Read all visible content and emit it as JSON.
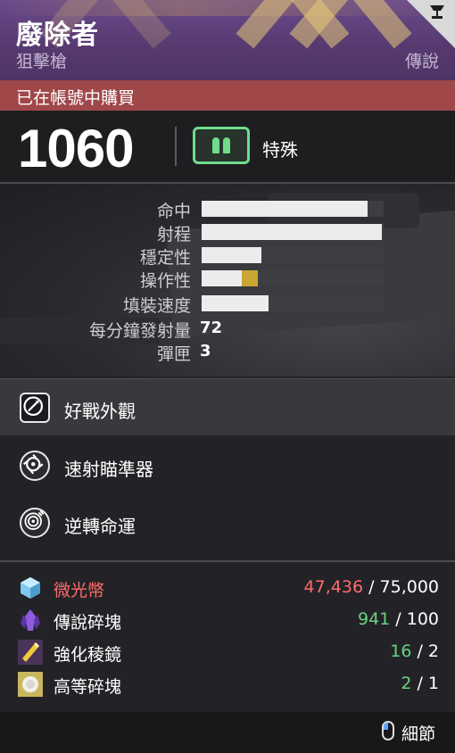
{
  "item": {
    "name": "廢除者",
    "type": "狙擊槍",
    "rarity": "傳說",
    "purchased_text": "已在帳號中購買",
    "power": "1060",
    "ammo_type": "特殊",
    "ammo_color": "#6fdc8c"
  },
  "stats": [
    {
      "label": "命中",
      "value": 91,
      "kind": "bar"
    },
    {
      "label": "射程",
      "value": 99,
      "kind": "bar"
    },
    {
      "label": "穩定性",
      "value": 33,
      "kind": "bar"
    },
    {
      "label": "操作性",
      "value": 22,
      "bonus": 9,
      "kind": "bar"
    },
    {
      "label": "填裝速度",
      "value": 37,
      "kind": "bar"
    },
    {
      "label": "每分鐘發射量",
      "value": "72",
      "kind": "number"
    },
    {
      "label": "彈匣",
      "value": "3",
      "kind": "number"
    }
  ],
  "perks": [
    {
      "label": "好戰外觀",
      "icon": "ornament-icon",
      "selected": true
    },
    {
      "label": "速射瞄準器",
      "icon": "scope-icon",
      "selected": false
    },
    {
      "label": "逆轉命運",
      "icon": "target-icon",
      "selected": false
    }
  ],
  "costs": [
    {
      "label": "微光幣",
      "have": "47,436",
      "need": "75,000",
      "enough": false,
      "icon": "glimmer-icon",
      "color": "#8fd3ff"
    },
    {
      "label": "傳說碎塊",
      "have": "941",
      "need": "100",
      "enough": true,
      "icon": "legendary-shards-icon",
      "color": "#7d4dc9"
    },
    {
      "label": "強化稜鏡",
      "have": "16",
      "need": "2",
      "enough": true,
      "icon": "enhancement-prism-icon",
      "color": "#e8c13a"
    },
    {
      "label": "高等碎塊",
      "have": "2",
      "need": "1",
      "enough": true,
      "icon": "ascendant-shard-icon",
      "color": "#e6d98a"
    }
  ],
  "cost_separator": " / ",
  "footer": {
    "label": "細節",
    "icon": "mouse-icon"
  }
}
